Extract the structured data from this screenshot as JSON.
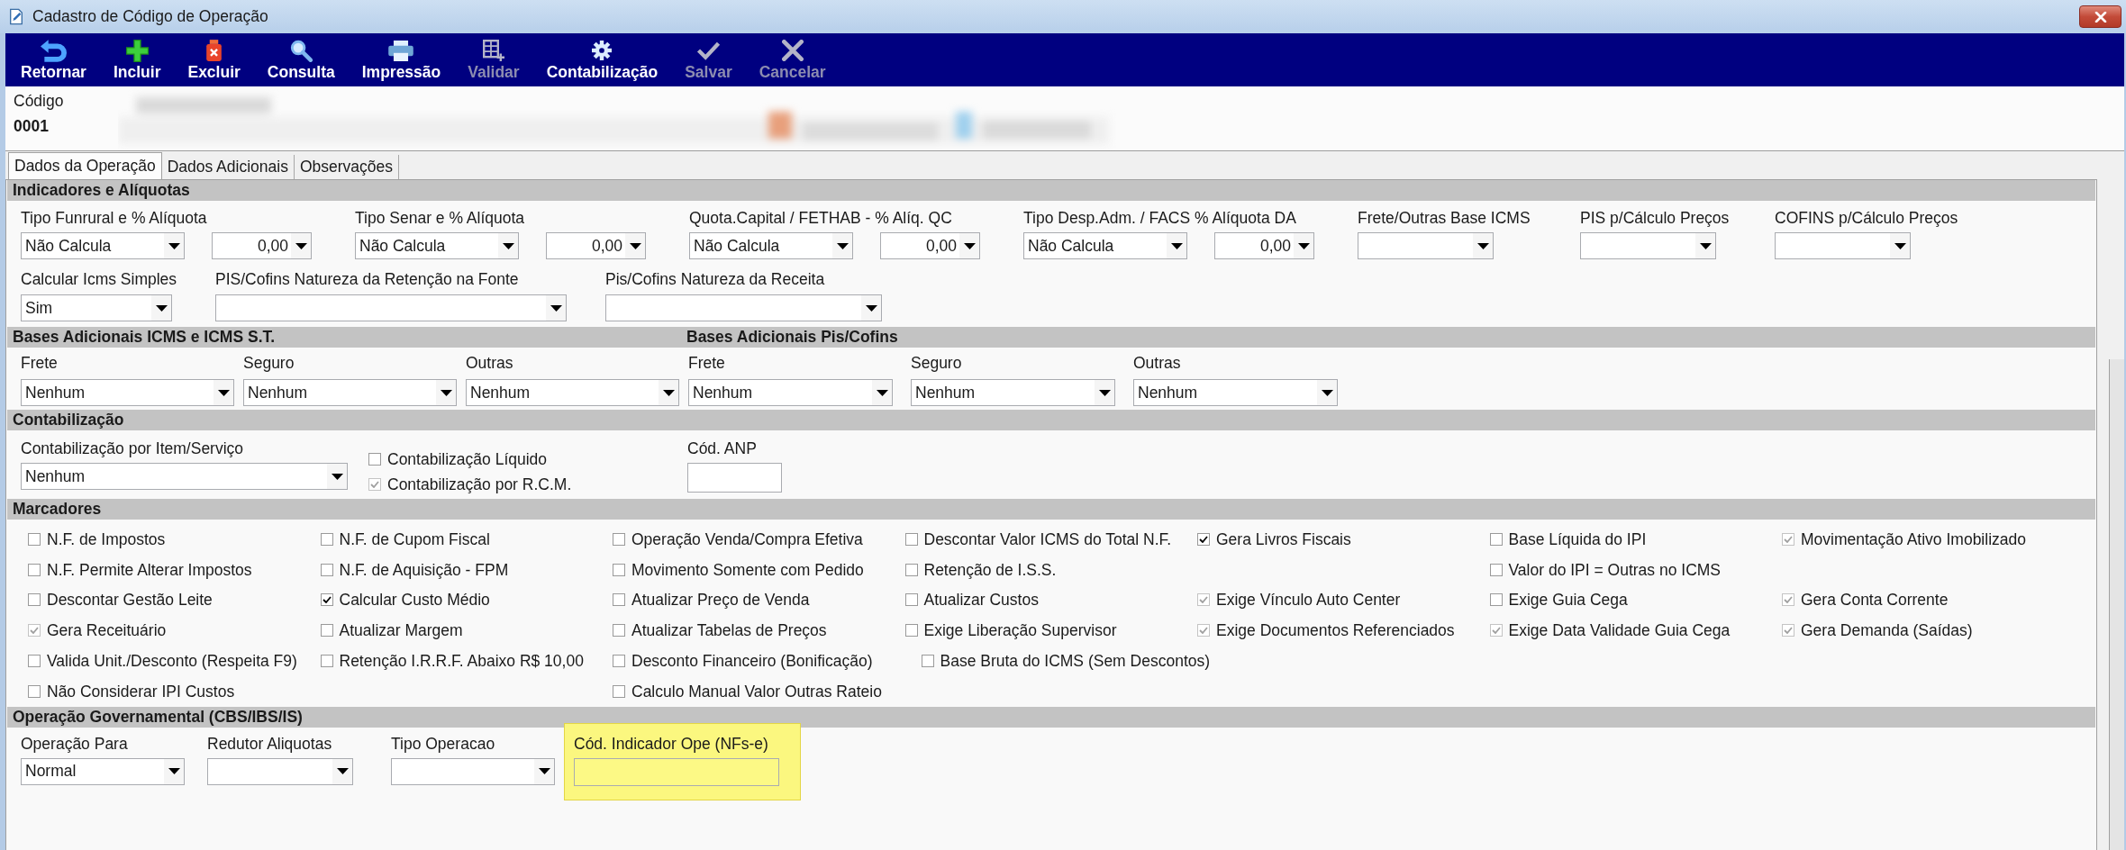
{
  "window": {
    "title": "Cadastro de Código de Operação"
  },
  "toolbar": [
    {
      "kind": "return",
      "label": "Retornar",
      "disabled": false
    },
    {
      "kind": "add",
      "label": "Incluir",
      "disabled": false
    },
    {
      "kind": "delete",
      "label": "Excluir",
      "disabled": false
    },
    {
      "kind": "search",
      "label": "Consulta",
      "disabled": false
    },
    {
      "kind": "print",
      "label": "Impressão",
      "disabled": false
    },
    {
      "kind": "validate",
      "label": "Validar",
      "disabled": true
    },
    {
      "kind": "accounting",
      "label": "Contabilização",
      "disabled": false
    },
    {
      "kind": "save",
      "label": "Salvar",
      "disabled": true
    },
    {
      "kind": "cancel",
      "label": "Cancelar",
      "disabled": true
    }
  ],
  "code": {
    "label": "Código",
    "value": "0001"
  },
  "tabs": [
    {
      "label": "Dados da Operação",
      "selected": true
    },
    {
      "label": "Dados Adicionais",
      "selected": false
    },
    {
      "label": "Observações",
      "selected": false
    }
  ],
  "indicators": {
    "title": "Indicadores e Alíquotas",
    "rows": [
      [
        {
          "label": "Tipo Funrural e % Alíquota",
          "controls": [
            {
              "kind": "combo",
              "value": "Não Calcula"
            },
            {
              "kind": "number",
              "value": "0,00"
            }
          ]
        },
        {
          "label": "Tipo Senar e % Alíquota",
          "controls": [
            {
              "kind": "combo",
              "value": "Não Calcula"
            },
            {
              "kind": "number",
              "value": "0,00"
            }
          ]
        },
        {
          "label": "Quota.Capital / FETHAB - % Alíq. QC",
          "controls": [
            {
              "kind": "combo",
              "value": "Não Calcula"
            },
            {
              "kind": "number",
              "value": "0,00"
            }
          ]
        },
        {
          "label": "Tipo Desp.Adm. / FACS % Alíquota DA",
          "controls": [
            {
              "kind": "combo",
              "value": "Não Calcula"
            },
            {
              "kind": "number",
              "value": "0,00"
            }
          ]
        },
        {
          "label": "Frete/Outras Base ICMS",
          "controls": [
            {
              "kind": "combo"
            }
          ]
        },
        {
          "label": "PIS p/Cálculo Preços",
          "controls": [
            {
              "kind": "combo"
            }
          ]
        },
        {
          "label": "COFINS p/Cálculo Preços",
          "controls": [
            {
              "kind": "combo"
            }
          ]
        }
      ],
      [
        {
          "label": "Calcular Icms Simples",
          "controls": [
            {
              "kind": "combo",
              "value": "Sim"
            }
          ]
        },
        {
          "label": "PIS/Cofins Natureza da Retenção na Fonte",
          "controls": [
            {
              "kind": "combo"
            }
          ]
        },
        {
          "label": "Pis/Cofins Natureza da Receita",
          "controls": [
            {
              "kind": "combo"
            }
          ]
        }
      ]
    ]
  },
  "bases": {
    "titles": [
      "Bases Adicionais ICMS e ICMS S.T.",
      "Bases Adicionais Pis/Cofins"
    ],
    "fields": [
      {
        "label": "Frete",
        "value": "Nenhum"
      },
      {
        "label": "Seguro",
        "value": "Nenhum"
      },
      {
        "label": "Outras",
        "value": "Nenhum"
      },
      {
        "label": "Frete",
        "value": "Nenhum"
      },
      {
        "label": "Seguro",
        "value": "Nenhum"
      },
      {
        "label": "Outras",
        "value": "Nenhum"
      }
    ]
  },
  "accounting": {
    "title": "Contabilização",
    "item_combo": {
      "label": "Contabilização por Item/Serviço",
      "value": "Nenhum"
    },
    "checkboxes": [
      {
        "label": "Contabilização Líquido",
        "checked": false,
        "disabled": false
      },
      {
        "label": "Contabilização por R.C.M.",
        "checked": true,
        "disabled": true
      }
    ],
    "anp": {
      "label": "Cód. ANP"
    }
  },
  "markers": {
    "title": "Marcadores",
    "items": [
      {
        "label": "N.F. de Impostos",
        "checked": false,
        "disabled": false
      },
      {
        "label": "N.F. de Cupom Fiscal",
        "checked": false,
        "disabled": false
      },
      {
        "label": "Operação Venda/Compra Efetiva",
        "checked": false,
        "disabled": false
      },
      {
        "label": "Descontar Valor ICMS do Total N.F.",
        "checked": false,
        "disabled": false
      },
      {
        "label": "Gera Livros Fiscais",
        "checked": true,
        "disabled": false
      },
      {
        "label": "Base Líquida do IPI",
        "checked": false,
        "disabled": false
      },
      {
        "label": "Movimentação Ativo Imobilizado",
        "checked": true,
        "disabled": true
      },
      {
        "label": "N.F. Permite Alterar Impostos",
        "checked": false,
        "disabled": false
      },
      {
        "label": "N.F. de Aquisição - FPM",
        "checked": false,
        "disabled": false
      },
      {
        "label": "Movimento Somente com Pedido",
        "checked": false,
        "disabled": false
      },
      {
        "label": "Retenção de I.S.S.",
        "checked": false,
        "disabled": false
      },
      {
        "label": "Valor do IPI = Outras no ICMS",
        "checked": false,
        "disabled": false
      },
      {
        "label": "Descontar Gestão Leite",
        "checked": false,
        "disabled": false
      },
      {
        "label": "Calcular Custo Médio",
        "checked": true,
        "disabled": false
      },
      {
        "label": "Atualizar Preço de Venda",
        "checked": false,
        "disabled": false
      },
      {
        "label": "Atualizar Custos",
        "checked": false,
        "disabled": false
      },
      {
        "label": "Exige Vínculo Auto Center",
        "checked": true,
        "disabled": true
      },
      {
        "label": "Exige Guia Cega",
        "checked": false,
        "disabled": false
      },
      {
        "label": "Gera Conta Corrente",
        "checked": true,
        "disabled": true
      },
      {
        "label": "Gera Receituário",
        "checked": true,
        "disabled": true
      },
      {
        "label": "Atualizar Margem",
        "checked": false,
        "disabled": false
      },
      {
        "label": "Atualizar Tabelas de Preços",
        "checked": false,
        "disabled": false
      },
      {
        "label": "Exige Liberação Supervisor",
        "checked": false,
        "disabled": false
      },
      {
        "label": "Exige Documentos Referenciados",
        "checked": true,
        "disabled": true
      },
      {
        "label": "Exige Data Validade Guia Cega",
        "checked": true,
        "disabled": true
      },
      {
        "label": "Gera Demanda (Saídas)",
        "checked": true,
        "disabled": true
      },
      {
        "label": "Valida Unit./Desconto (Respeita F9)",
        "checked": false,
        "disabled": false
      },
      {
        "label": "Retenção I.R.R.F. Abaixo R$ 10,00",
        "checked": false,
        "disabled": false
      },
      {
        "label": "Desconto Financeiro (Bonificação)",
        "checked": false,
        "disabled": false
      },
      {
        "label": "Base Bruta do ICMS (Sem Descontos)",
        "checked": false,
        "disabled": false
      },
      {
        "label": "Não Considerar IPI Custos",
        "checked": false,
        "disabled": false
      },
      {
        "label": "Calculo Manual Valor Outras Rateio",
        "checked": false,
        "disabled": false
      }
    ]
  },
  "government": {
    "title": "Operação Governamental (CBS/IBS/IS)",
    "fields": [
      {
        "kind": "combo",
        "label": "Operação Para",
        "value": "Normal",
        "highlighted": false
      },
      {
        "kind": "combo",
        "label": "Redutor Aliquotas",
        "highlighted": false
      },
      {
        "kind": "combo",
        "label": "Tipo Operacao",
        "highlighted": false
      },
      {
        "kind": "text",
        "label": "Cód. Indicador Ope (NFs-e)",
        "highlighted": true
      }
    ]
  }
}
